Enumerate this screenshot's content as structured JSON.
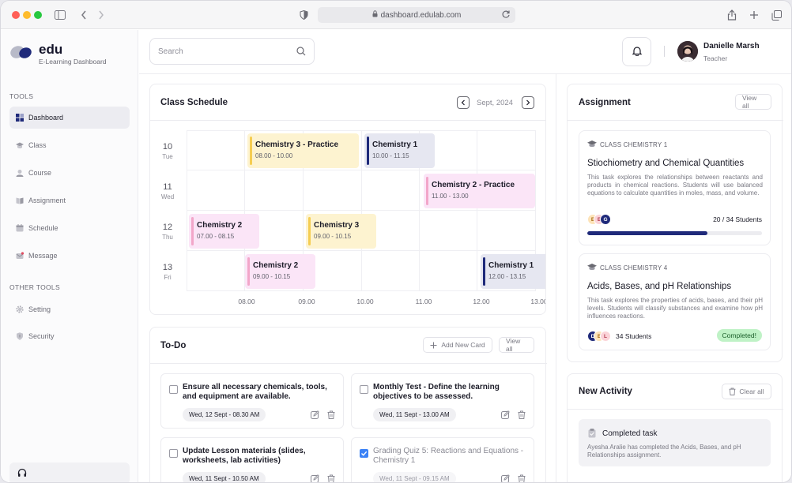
{
  "browser": {
    "url": "dashboard.edulab.com"
  },
  "brand": {
    "name": "edu",
    "subtitle": "E-Learning Dashboard"
  },
  "sidebar": {
    "tools_title": "TOOLS",
    "items": [
      {
        "label": "Dashboard",
        "icon": "dashboard-icon",
        "active": true
      },
      {
        "label": "Class",
        "icon": "graduation-cap-icon"
      },
      {
        "label": "Course",
        "icon": "course-icon"
      },
      {
        "label": "Assignment",
        "icon": "book-icon"
      },
      {
        "label": "Schedule",
        "icon": "calendar-icon"
      },
      {
        "label": "Message",
        "icon": "message-icon"
      }
    ],
    "other_title": "OTHER TOOLS",
    "other_items": [
      {
        "label": "Setting",
        "icon": "gear-icon"
      },
      {
        "label": "Security",
        "icon": "shield-icon"
      }
    ]
  },
  "header": {
    "search_placeholder": "Search",
    "user": {
      "name": "Danielle Marsh",
      "role": "Teacher"
    }
  },
  "schedule": {
    "title": "Class Schedule",
    "month": "Sept, 2024",
    "days": [
      {
        "num": "10",
        "name": "Tue"
      },
      {
        "num": "11",
        "name": "Wed"
      },
      {
        "num": "12",
        "name": "Thu"
      },
      {
        "num": "13",
        "name": "Fri"
      }
    ],
    "times": [
      "08.00",
      "09.00",
      "10.00",
      "11.00",
      "12.00",
      "13.00"
    ],
    "events": [
      {
        "name": "Chemistry 3 - Practice",
        "time": "08.00 - 10.00"
      },
      {
        "name": "Chemistry 1",
        "time": "10.00 - 11.15"
      },
      {
        "name": "Chemistry 2 - Practice",
        "time": "11.00 - 13.00"
      },
      {
        "name": "Chemistry 2",
        "time": "07.00 - 08.15"
      },
      {
        "name": "Chemistry 3",
        "time": "09.00 - 10.15"
      },
      {
        "name": "Chemistry 2",
        "time": "09.00 - 10.15"
      },
      {
        "name": "Chemistry 1",
        "time": "12.00 - 13.15"
      }
    ]
  },
  "todo": {
    "title": "To-Do",
    "add_label": "Add New Card",
    "view_all": "View all",
    "items": [
      {
        "text": "Ensure all necessary chemicals, tools, and equipment are available.",
        "date": "Wed, 12 Sept - 08.30 AM",
        "done": false
      },
      {
        "text": "Monthly Test - Define the learning objectives to be assessed.",
        "date": "Wed, 11 Sept - 13.00 AM",
        "done": false
      },
      {
        "text": "Update Lesson materials (slides, worksheets, lab activities)",
        "date": "Wed, 11 Sept - 10.50 AM",
        "done": false
      },
      {
        "text": "Grading Quiz 5: Reactions and Equations - Chemistry 1",
        "date": "Wed, 11 Sept - 09.15 AM",
        "done": true
      }
    ]
  },
  "assignment": {
    "title": "Assignment",
    "view_all": "View all",
    "items": [
      {
        "class": "CLASS CHEMISTRY 1",
        "title": "Stiochiometry and Chemical Quantities",
        "desc": "This task explores the relationships between reactants and products in chemical reactions. Students will use balanced equations to calculate quantities in moles, mass, and volume.",
        "avatars": [
          "E",
          "E",
          "G"
        ],
        "count": "20 / 34 Students",
        "progress": 0.69
      },
      {
        "class": "CLASS CHEMISTRY 4",
        "title": "Acids, Bases, and pH Relationships",
        "desc": "This task explores the properties of acids, bases, and their pH levels. Students will classify substances and examine how pH influences reactions.",
        "avatars": [
          "D",
          "E",
          "L"
        ],
        "count": "34 Students",
        "status": "Completed!"
      }
    ]
  },
  "activity": {
    "title": "New Activity",
    "clear_all": "Clear all",
    "items": [
      {
        "title": "Completed task",
        "desc": "Ayesha Aralie has completed the Acids, Bases, and pH Relationships assignment."
      }
    ]
  },
  "colors": {
    "accent": "#1f2a7a",
    "yellow_event": "#fdf3d0",
    "navy_event": "#e6e7f1",
    "pink_event": "#fbe5f7",
    "completed_badge": "#bff2c6"
  }
}
